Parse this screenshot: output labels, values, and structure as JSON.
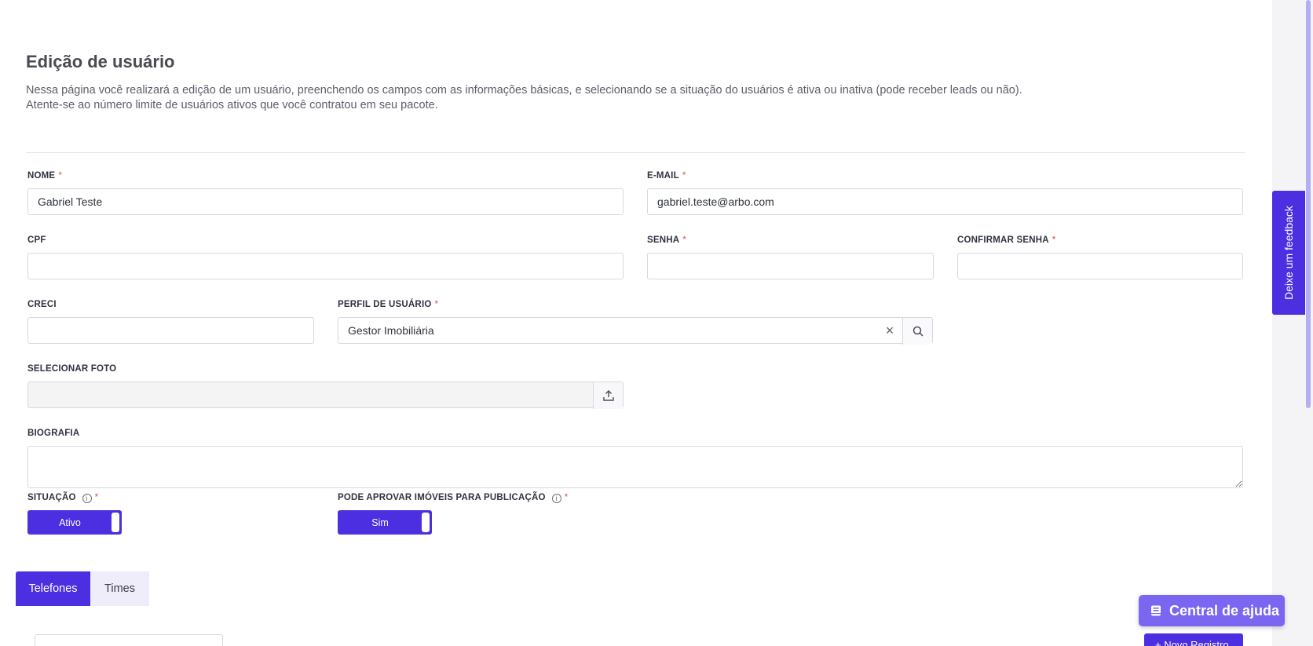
{
  "page": {
    "title": "Edição de usuário",
    "description_line1": "Nessa página você realizará a edição de um usuário, preenchendo os campos com as informações básicas, e selecionando se a situação do usuários é ativa ou inativa (pode receber leads ou não).",
    "description_line2": "Atente-se ao número limite de usuários ativos que você contratou em seu pacote."
  },
  "form": {
    "required_mark": "*",
    "nome": {
      "label": "NOME",
      "value": "Gabriel Teste"
    },
    "email": {
      "label": "E-MAIL",
      "value": "gabriel.teste@arbo.com"
    },
    "cpf": {
      "label": "CPF",
      "value": ""
    },
    "senha": {
      "label": "SENHA",
      "value": ""
    },
    "confirmar_senha": {
      "label": "CONFIRMAR SENHA",
      "value": ""
    },
    "creci": {
      "label": "CRECI",
      "value": ""
    },
    "perfil": {
      "label": "PERFIL DE USUÁRIO",
      "value": "Gestor Imobiliária"
    },
    "foto": {
      "label": "SELECIONAR FOTO",
      "value": ""
    },
    "biografia": {
      "label": "BIOGRAFIA",
      "value": ""
    },
    "situacao": {
      "label": "SITUAÇÃO",
      "toggle_label": "Ativo"
    },
    "aprovar": {
      "label": "PODE APROVAR IMÓVEIS PARA PUBLICAÇÃO",
      "toggle_label": "Sim"
    }
  },
  "tabs": [
    {
      "label": "Telefones",
      "active": true
    },
    {
      "label": "Times",
      "active": false
    }
  ],
  "actions": {
    "new_record_label": "+ Novo Registro"
  },
  "feedback_tab": {
    "label": "Deixe um feedback"
  },
  "help_button": {
    "label": "Central de ajuda"
  },
  "colors": {
    "primary": "#4b2fe0",
    "help": "#7a66f0",
    "required": "#e5484d"
  }
}
